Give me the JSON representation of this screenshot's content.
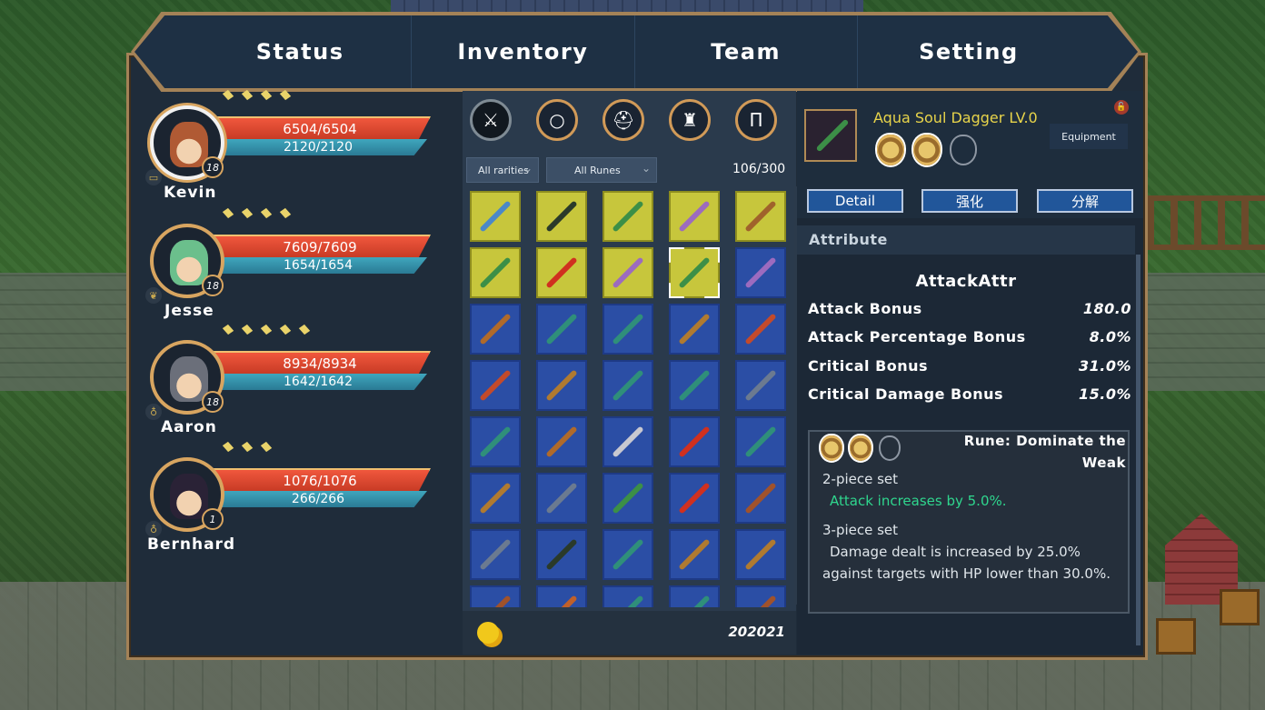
{
  "tabs": [
    "Status",
    "Inventory",
    "Team",
    "Setting"
  ],
  "team": [
    {
      "name": "Kevin",
      "hp": "6504/6504",
      "mp": "2120/2120",
      "level": "18",
      "stars": 4,
      "hair": "#b05a34",
      "class_icon": "book-icon"
    },
    {
      "name": "Jesse",
      "hp": "7609/7609",
      "mp": "1654/1654",
      "level": "18",
      "stars": 4,
      "hair": "#6bbf8c",
      "class_icon": "leaf-icon"
    },
    {
      "name": "Aaron",
      "hp": "8934/8934",
      "mp": "1642/1642",
      "level": "18",
      "stars": 5,
      "hair": "#6b6f7a",
      "class_icon": "drop-icon"
    },
    {
      "name": "Bernhard",
      "hp": "1076/1076",
      "mp": "266/266",
      "level": "1",
      "stars": 3,
      "hair": "#2a2236",
      "class_icon": "drop-icon"
    }
  ],
  "inventory": {
    "categories": [
      "sword-icon",
      "ring-icon",
      "helmet-icon",
      "armor-icon",
      "pants-icon"
    ],
    "filter_rarity": "All rarities",
    "filter_runes": "All Runes",
    "count": "106/300",
    "money": "202021",
    "slots": [
      [
        "gold",
        "#4a88c8"
      ],
      [
        "gold",
        "#2a3a2a"
      ],
      [
        "gold",
        "#3c8f47"
      ],
      [
        "gold",
        "#9c6bbf"
      ],
      [
        "gold",
        "#a0622b"
      ],
      [
        "gold",
        "#3c8f47"
      ],
      [
        "gold",
        "#d0301f"
      ],
      [
        "gold",
        "#9c6bbf"
      ],
      [
        "gold",
        "#3c8f47"
      ],
      [
        "blue",
        "#9c6bbf"
      ],
      [
        "blue",
        "#b06a2a"
      ],
      [
        "blue",
        "#2f8f7a"
      ],
      [
        "blue",
        "#2f8f7a"
      ],
      [
        "blue",
        "#b07a30"
      ],
      [
        "blue",
        "#c44a2a"
      ],
      [
        "blue",
        "#c44a2a"
      ],
      [
        "blue",
        "#b07a30"
      ],
      [
        "blue",
        "#2f8f7a"
      ],
      [
        "blue",
        "#2f8f7a"
      ],
      [
        "blue",
        "#6b7a90"
      ],
      [
        "blue",
        "#2f8f7a"
      ],
      [
        "blue",
        "#b06a2a"
      ],
      [
        "blue",
        "#c8c8d0"
      ],
      [
        "blue",
        "#d0301f"
      ],
      [
        "blue",
        "#2f8f7a"
      ],
      [
        "blue",
        "#b07a30"
      ],
      [
        "blue",
        "#6b7a90"
      ],
      [
        "blue",
        "#3c8f47"
      ],
      [
        "blue",
        "#d0301f"
      ],
      [
        "blue",
        "#a0522b"
      ],
      [
        "blue",
        "#6b7a90"
      ],
      [
        "blue",
        "#2a3a2a"
      ],
      [
        "blue",
        "#2f8f7a"
      ],
      [
        "blue",
        "#b07a30"
      ],
      [
        "blue",
        "#b07a30"
      ],
      [
        "blue",
        "#a0522b"
      ],
      [
        "blue",
        "#c0602a"
      ],
      [
        "blue",
        "#2f8f7a"
      ],
      [
        "blue",
        "#2f8f7a"
      ],
      [
        "blue",
        "#a0522b"
      ]
    ]
  },
  "detail": {
    "item_name": "Aqua Soul Dagger LV.0",
    "equip_label": "Equipment",
    "buttons": [
      "Detail",
      "强化",
      "分解"
    ],
    "section_title": "Attribute",
    "attr_header": "AttackAttr",
    "attributes": [
      {
        "label": "Attack Bonus",
        "value": "180.0"
      },
      {
        "label": "Attack Percentage Bonus",
        "value": "8.0%"
      },
      {
        "label": "Critical Bonus",
        "value": "31.0%"
      },
      {
        "label": "Critical Damage Bonus",
        "value": "15.0%"
      }
    ],
    "rune_name": "Rune: Dominate the Weak",
    "set2_title": "2-piece set",
    "set2_text": "Attack increases by 5.0%.",
    "set3_title": "3-piece set",
    "set3_text": "Damage dealt is increased by 25.0% against targets with HP lower than 30.0%.",
    "colors": {
      "item_name": "#e8d44a",
      "set_bonus_active": "#2fd68e"
    }
  }
}
